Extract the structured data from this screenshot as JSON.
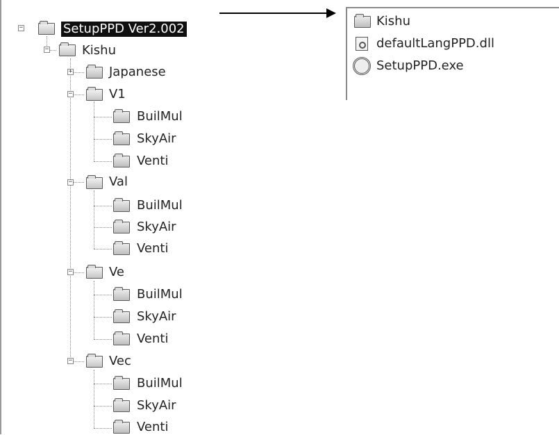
{
  "tree": {
    "root": "SetupPPD Ver2.002",
    "kishu": "Kishu",
    "japanese": "Japanese",
    "groups": [
      {
        "name": "V1",
        "children": [
          "BuilMul",
          "SkyAir",
          "Venti"
        ]
      },
      {
        "name": "Val",
        "children": [
          "BuilMul",
          "SkyAir",
          "Venti"
        ]
      },
      {
        "name": "Ve",
        "children": [
          "BuilMul",
          "SkyAir",
          "Venti"
        ]
      },
      {
        "name": "Vec",
        "children": [
          "BuilMul",
          "SkyAir",
          "Venti"
        ]
      }
    ]
  },
  "files": [
    {
      "name": "Kishu",
      "icon": "folder-icon"
    },
    {
      "name": "defaultLangPPD.dll",
      "icon": "dll-file-icon"
    },
    {
      "name": "SetupPPD.exe",
      "icon": "exe-file-icon"
    }
  ]
}
